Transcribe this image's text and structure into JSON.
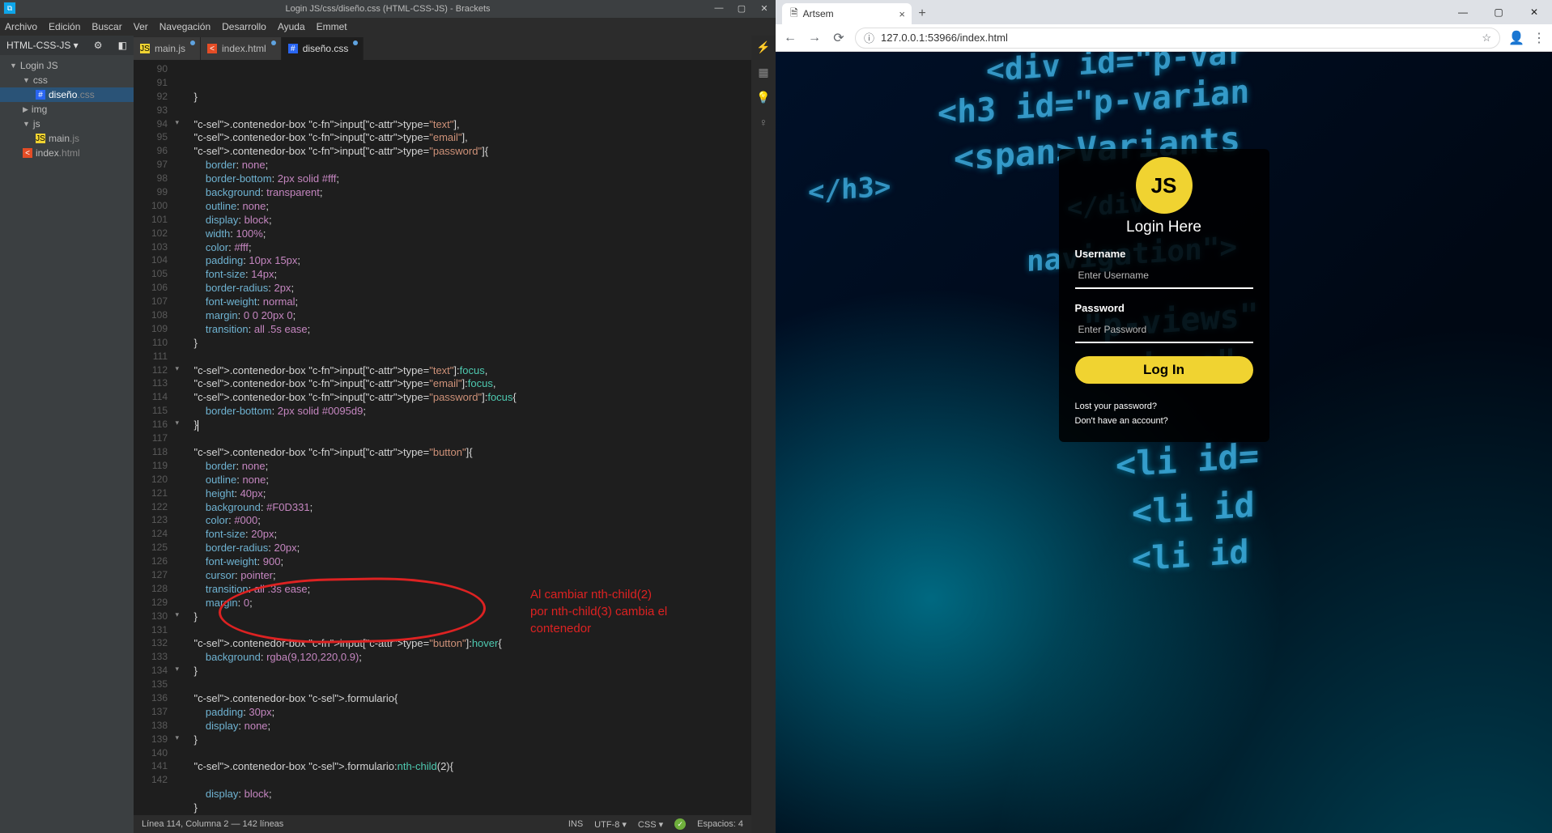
{
  "brackets": {
    "title": "Login JS/css/diseño.css (HTML-CSS-JS) - Brackets",
    "menu": [
      "Archivo",
      "Edición",
      "Buscar",
      "Ver",
      "Navegación",
      "Desarrollo",
      "Ayuda",
      "Emmet"
    ],
    "project_label": "HTML-CSS-JS",
    "tree": {
      "root": "Login JS",
      "folders": [
        {
          "name": "css",
          "children": [
            {
              "name": "diseño",
              "ext": ".css",
              "type": "css",
              "selected": true
            }
          ]
        },
        {
          "name": "img",
          "children": []
        },
        {
          "name": "js",
          "children": [
            {
              "name": "main",
              "ext": ".js",
              "type": "js"
            }
          ]
        }
      ],
      "root_files": [
        {
          "name": "index",
          "ext": ".html",
          "type": "html"
        }
      ]
    },
    "tabs": [
      {
        "icon": "js",
        "label": "main.js",
        "active": false
      },
      {
        "icon": "html",
        "label": "index.html",
        "active": false
      },
      {
        "icon": "css",
        "label": "diseño.css",
        "active": true
      }
    ],
    "status_left": "Línea 114, Columna 2 — 142 líneas",
    "status_ins": "INS",
    "status_enc": "UTF-8 ▾",
    "status_lang": "CSS ▾",
    "status_spaces": "Espacios: 4",
    "annotation": "Al cambiar nth-child(2)\npor nth-child(3) cambia el\ncontenedor",
    "code_lines": [
      {
        "n": 90,
        "t": "    }"
      },
      {
        "n": 91,
        "t": ""
      },
      {
        "n": 92,
        "t": "    .contenedor-box input[type=\"text\"],"
      },
      {
        "n": 93,
        "t": "    .contenedor-box input[type=\"email\"],"
      },
      {
        "n": 94,
        "t": "    .contenedor-box input[type=\"password\"]{",
        "fold": true
      },
      {
        "n": 95,
        "t": "        border: none;"
      },
      {
        "n": 96,
        "t": "        border-bottom: 2px solid #fff;"
      },
      {
        "n": 97,
        "t": "        background: transparent;"
      },
      {
        "n": 98,
        "t": "        outline: none;"
      },
      {
        "n": 99,
        "t": "        display: block;"
      },
      {
        "n": 100,
        "t": "        width: 100%;"
      },
      {
        "n": 101,
        "t": "        color: #fff;"
      },
      {
        "n": 102,
        "t": "        padding: 10px 15px;"
      },
      {
        "n": 103,
        "t": "        font-size: 14px;"
      },
      {
        "n": 104,
        "t": "        border-radius: 2px;"
      },
      {
        "n": 105,
        "t": "        font-weight: normal;"
      },
      {
        "n": 106,
        "t": "        margin: 0 0 20px 0;"
      },
      {
        "n": 107,
        "t": "        transition: all .5s ease;"
      },
      {
        "n": 108,
        "t": "    }"
      },
      {
        "n": 109,
        "t": ""
      },
      {
        "n": 110,
        "t": "    .contenedor-box input[type=\"text\"]:focus,"
      },
      {
        "n": 111,
        "t": "    .contenedor-box input[type=\"email\"]:focus,"
      },
      {
        "n": 112,
        "t": "    .contenedor-box input[type=\"password\"]:focus{",
        "fold": true
      },
      {
        "n": 113,
        "t": "        border-bottom: 2px solid #0095d9;"
      },
      {
        "n": 114,
        "t": "    }",
        "cursor": true
      },
      {
        "n": 115,
        "t": ""
      },
      {
        "n": 116,
        "t": "    .contenedor-box input[type=\"button\"]{",
        "fold": true
      },
      {
        "n": 117,
        "t": "        border: none;"
      },
      {
        "n": 118,
        "t": "        outline: none;"
      },
      {
        "n": 119,
        "t": "        height: 40px;"
      },
      {
        "n": 120,
        "t": "        background: #F0D331;"
      },
      {
        "n": 121,
        "t": "        color: #000;"
      },
      {
        "n": 122,
        "t": "        font-size: 20px;"
      },
      {
        "n": 123,
        "t": "        border-radius: 20px;"
      },
      {
        "n": 124,
        "t": "        font-weight: 900;"
      },
      {
        "n": 125,
        "t": "        cursor: pointer;"
      },
      {
        "n": 126,
        "t": "        transition: all .3s ease;"
      },
      {
        "n": 127,
        "t": "        margin: 0;"
      },
      {
        "n": 128,
        "t": "    }"
      },
      {
        "n": 129,
        "t": ""
      },
      {
        "n": 130,
        "t": "    .contenedor-box input[type=\"button\"]:hover{",
        "fold": true
      },
      {
        "n": 131,
        "t": "        background: rgba(9,120,220,0.9);"
      },
      {
        "n": 132,
        "t": "    }"
      },
      {
        "n": 133,
        "t": ""
      },
      {
        "n": 134,
        "t": "    .contenedor-box .formulario{",
        "fold": true
      },
      {
        "n": 135,
        "t": "        padding: 30px;"
      },
      {
        "n": 136,
        "t": "        display: none;"
      },
      {
        "n": 137,
        "t": "    }"
      },
      {
        "n": 138,
        "t": ""
      },
      {
        "n": 139,
        "t": "    .contenedor-box .formulario:nth-child(2){",
        "fold": true
      },
      {
        "n": 140,
        "t": ""
      },
      {
        "n": 141,
        "t": "        display: block;"
      },
      {
        "n": 142,
        "t": "    }"
      }
    ]
  },
  "chrome": {
    "tab_title": "Artsem",
    "url": "127.0.0.1:53966/index.html",
    "login": {
      "logo": "JS",
      "title": "Login Here",
      "user_label": "Username",
      "user_placeholder": "Enter Username",
      "pass_label": "Password",
      "pass_placeholder": "Enter Password",
      "button": "Log In",
      "link1": "Lost your password?",
      "link2": "Don't have an account?"
    },
    "bg_lines": [
      "<div   id=\"p-var",
      "<h3 id=\"p-varian",
      "<span>Variants",
      "</h3>",
      "</div>",
      "navigation\">",
      "\"p-views\"",
      "-views\"",
      "<li id=",
      "<li id",
      "<li id"
    ]
  }
}
